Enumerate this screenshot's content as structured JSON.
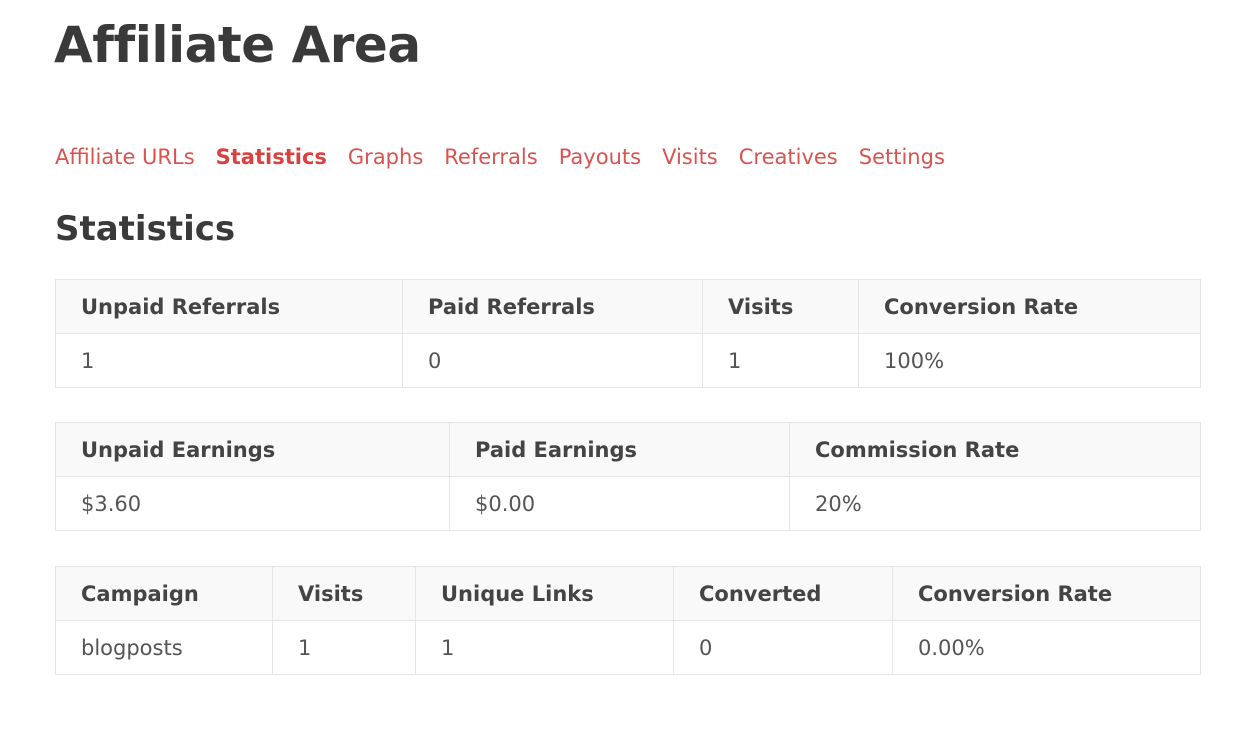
{
  "page_title": "Affiliate Area",
  "tabs": [
    {
      "label": "Affiliate URLs",
      "active": false
    },
    {
      "label": "Statistics",
      "active": true
    },
    {
      "label": "Graphs",
      "active": false
    },
    {
      "label": "Referrals",
      "active": false
    },
    {
      "label": "Payouts",
      "active": false
    },
    {
      "label": "Visits",
      "active": false
    },
    {
      "label": "Creatives",
      "active": false
    },
    {
      "label": "Settings",
      "active": false
    }
  ],
  "section_title": "Statistics",
  "colors": {
    "accent": "#d9534f",
    "heading": "#3a3a3a",
    "border": "#e6e6e6"
  },
  "referral_stats": {
    "headers": [
      "Unpaid Referrals",
      "Paid Referrals",
      "Visits",
      "Conversion Rate"
    ],
    "row": [
      "1",
      "0",
      "1",
      "100%"
    ]
  },
  "earnings_stats": {
    "headers": [
      "Unpaid Earnings",
      "Paid Earnings",
      "Commission Rate"
    ],
    "row": [
      "$3.60",
      "$0.00",
      "20%"
    ]
  },
  "campaign_stats": {
    "headers": [
      "Campaign",
      "Visits",
      "Unique Links",
      "Converted",
      "Conversion Rate"
    ],
    "rows": [
      [
        "blogposts",
        "1",
        "1",
        "0",
        "0.00%"
      ]
    ]
  }
}
